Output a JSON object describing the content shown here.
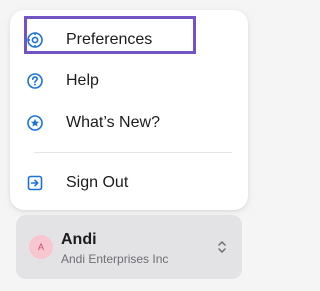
{
  "menu": {
    "items": [
      {
        "label": "Preferences",
        "icon": "settings-icon"
      },
      {
        "label": "Help",
        "icon": "help-icon"
      },
      {
        "label": "What’s New?",
        "icon": "star-icon"
      },
      {
        "label": "Sign Out",
        "icon": "sign-out-icon"
      }
    ]
  },
  "account": {
    "initial": "A",
    "name": "Andi",
    "organization": "Andi Enterprises Inc",
    "icon": "chevron-up-down-icon"
  },
  "colors": {
    "accent": "#1a73d9",
    "highlight": "#7254c4",
    "avatar_bg": "#f7c6cf",
    "avatar_text": "#d0467a"
  }
}
